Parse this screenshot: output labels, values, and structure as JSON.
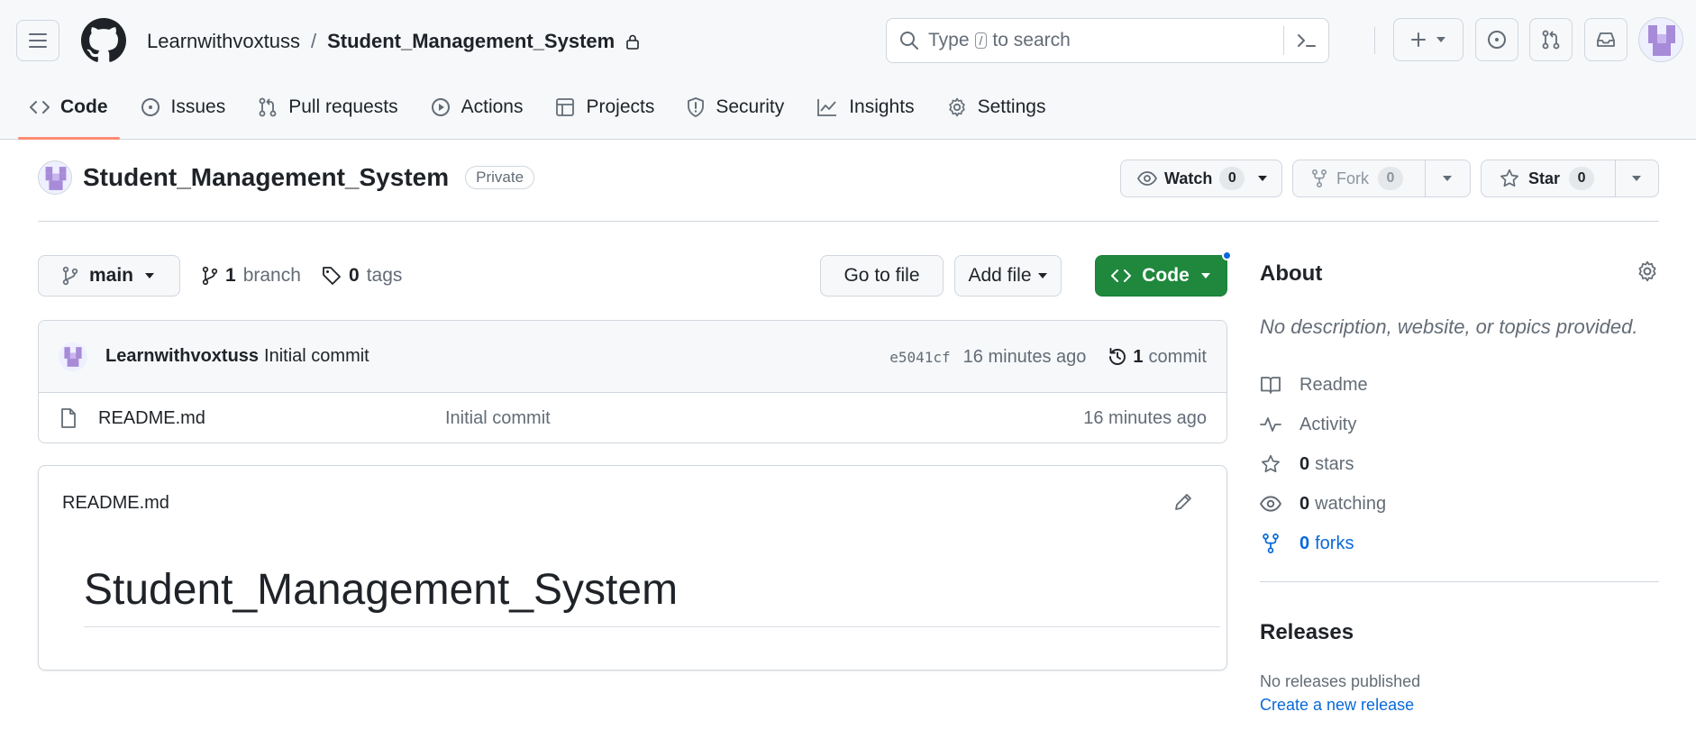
{
  "header": {
    "owner": "Learnwithvoxtuss",
    "separator": "/",
    "repo": "Student_Management_System",
    "search_placeholder_before": "Type",
    "search_key": "/",
    "search_placeholder_after": "to search"
  },
  "nav": {
    "tabs": [
      {
        "label": "Code",
        "icon": "code-icon"
      },
      {
        "label": "Issues",
        "icon": "issue-circle-icon"
      },
      {
        "label": "Pull requests",
        "icon": "pull-request-icon"
      },
      {
        "label": "Actions",
        "icon": "play-icon"
      },
      {
        "label": "Projects",
        "icon": "table-icon"
      },
      {
        "label": "Security",
        "icon": "shield-icon"
      },
      {
        "label": "Insights",
        "icon": "graph-icon"
      },
      {
        "label": "Settings",
        "icon": "gear-icon"
      }
    ]
  },
  "repo_header": {
    "title": "Student_Management_System",
    "visibility": "Private",
    "watch_label": "Watch",
    "watch_count": "0",
    "fork_label": "Fork",
    "fork_count": "0",
    "star_label": "Star",
    "star_count": "0"
  },
  "toolbar": {
    "branch": "main",
    "branch_count": "1",
    "branch_label": "branch",
    "tag_count": "0",
    "tag_label": "tags",
    "goto_file": "Go to file",
    "add_file": "Add file",
    "code": "Code"
  },
  "latest_commit": {
    "author": "Learnwithvoxtuss",
    "message": "Initial commit",
    "sha": "e5041cf",
    "time": "16 minutes ago",
    "commit_count": "1",
    "commit_label": "commit"
  },
  "files": [
    {
      "name": "README.md",
      "message": "Initial commit",
      "time": "16 minutes ago"
    }
  ],
  "readme": {
    "filename": "README.md",
    "heading": "Student_Management_System"
  },
  "about": {
    "title": "About",
    "description": "No description, website, or topics provided.",
    "readme": "Readme",
    "activity": "Activity",
    "stars_count": "0",
    "stars_label": "stars",
    "watching_count": "0",
    "watching_label": "watching",
    "forks_count": "0",
    "forks_label": "forks"
  },
  "releases": {
    "title": "Releases",
    "none": "No releases published",
    "create": "Create a new release"
  },
  "colors": {
    "accent_green": "#1f883d",
    "link_blue": "#0969da",
    "tab_underline": "#fd8c73"
  }
}
